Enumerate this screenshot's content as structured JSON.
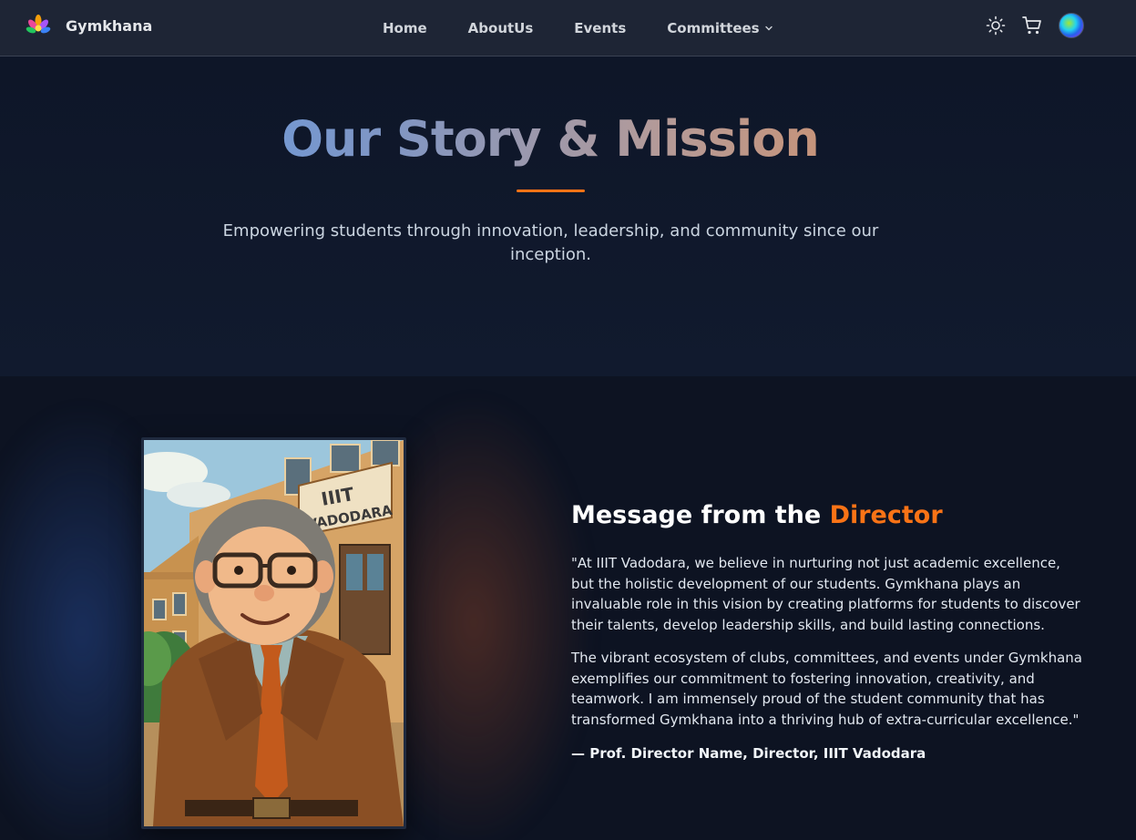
{
  "navbar": {
    "brand": "Gymkhana",
    "links": [
      "Home",
      "AboutUs",
      "Events",
      "Committees"
    ],
    "icons": [
      "sun-icon",
      "cart-icon",
      "avatar"
    ]
  },
  "hero": {
    "title": "Our Story & Mission",
    "subtitle": "Empowering students through innovation, leadership, and community since our inception."
  },
  "director": {
    "heading_prefix": "Message from the ",
    "heading_accent": "Director",
    "paragraph_1": "\"At IIIT Vadodara, we believe in nurturing not just academic excellence, but the holistic development of our students. Gymkhana plays an invaluable role in this vision by creating platforms for students to discover their talents, develop leadership skills, and build lasting connections.",
    "paragraph_2": "The vibrant ecosystem of clubs, committees, and events under Gymkhana exemplifies our commitment to fostering innovation, creativity, and teamwork. I am immensely proud of the student community that has transformed Gymkhana into a thriving hub of extra-curricular excellence.\"",
    "signature": "— Prof. Director Name, Director, IIIT Vadodara",
    "portrait_sign": "IIIT VADODARA"
  },
  "colors": {
    "accent": "#f97316",
    "background": "#0f172a",
    "navbar": "#1e2535"
  }
}
